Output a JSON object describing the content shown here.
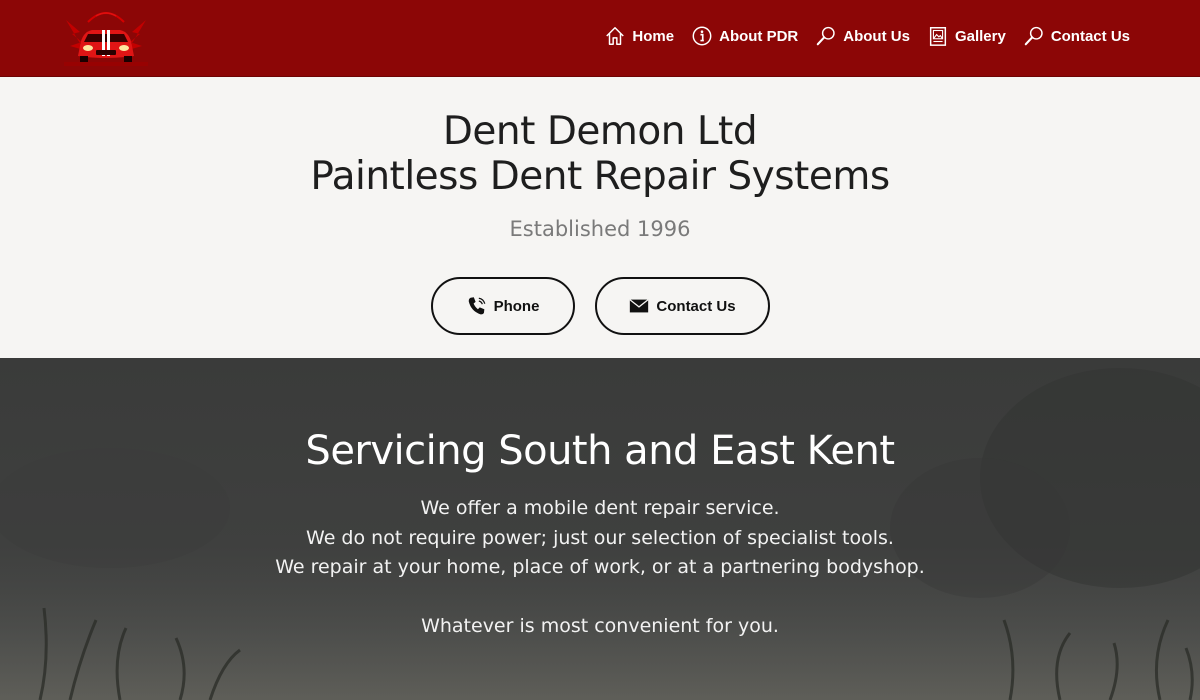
{
  "nav": {
    "logo_alt": "Dent Demon logo",
    "items": [
      {
        "label": "Home",
        "icon": "home-icon"
      },
      {
        "label": "About PDR",
        "icon": "info-icon"
      },
      {
        "label": "About Us",
        "icon": "magnifier-icon"
      },
      {
        "label": "Gallery",
        "icon": "gallery-icon"
      },
      {
        "label": "Contact Us",
        "icon": "magnifier-icon"
      }
    ]
  },
  "hero": {
    "title_line1": "Dent Demon Ltd",
    "title_line2": "Paintless Dent Repair Systems",
    "subtitle": "Established 1996",
    "buttons": {
      "phone": {
        "label": "Phone",
        "icon": "phone-icon"
      },
      "contact": {
        "label": "Contact Us",
        "icon": "envelope-icon"
      }
    }
  },
  "service": {
    "title": "Servicing South and East Kent",
    "lines": [
      "We offer a mobile dent repair service.",
      "We do not require power; just our selection of specialist tools.",
      "We repair at your home, place of work, or at a partnering bodyshop."
    ],
    "closing": "Whatever is most convenient for you."
  },
  "colors": {
    "navbar": "#8c0606",
    "hero_bg": "#f6f5f3",
    "service_bg": "#3f403f",
    "text_dark": "#1e1e1e",
    "text_muted": "#7a7a7a",
    "text_light": "#ffffff"
  }
}
